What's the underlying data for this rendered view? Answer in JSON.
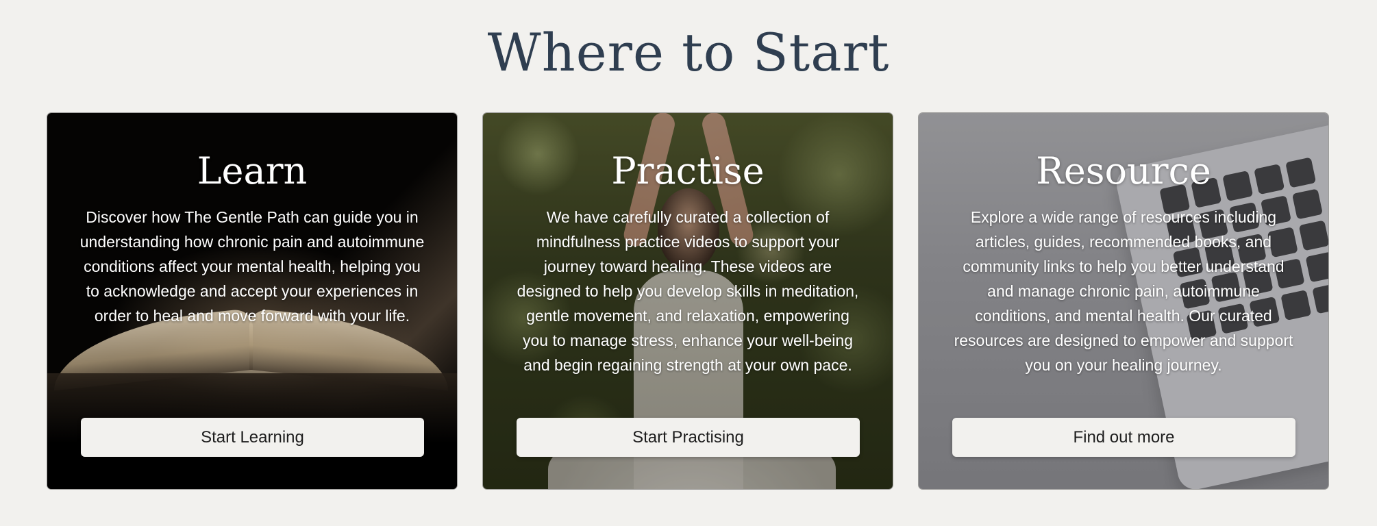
{
  "section": {
    "title": "Where to Start"
  },
  "cards": [
    {
      "id": "learn",
      "title": "Learn",
      "description": "Discover how The Gentle Path can guide you in understanding how chronic pain and autoimmune conditions affect your mental health, helping you to acknowledge and accept your experiences in order to heal and move forward with your life.",
      "button_label": "Start Learning",
      "background": "open-book-image"
    },
    {
      "id": "practise",
      "title": "Practise",
      "description": "We have carefully curated a collection of mindfulness practice videos to support your journey toward healing. These videos are designed to help you develop skills in meditation, gentle movement, and relaxation, empowering you to manage stress, enhance your well-being and begin regaining strength at your own pace.",
      "button_label": "Start Practising",
      "background": "meditating-woman-forest-image"
    },
    {
      "id": "resource",
      "title": "Resource",
      "description": "Explore a wide range of resources including articles, guides, recommended books, and community links to help you better understand and manage chronic pain, autoimmune conditions, and mental health. Our curated resources are designed to empower and support you on your healing journey.",
      "button_label": "Find out more",
      "background": "laptop-keyboard-image"
    }
  ],
  "colors": {
    "page_background": "#f2f1ee",
    "title_color": "#2f3e50",
    "button_background": "#f2f1ee",
    "button_text": "#1d1d1d"
  }
}
